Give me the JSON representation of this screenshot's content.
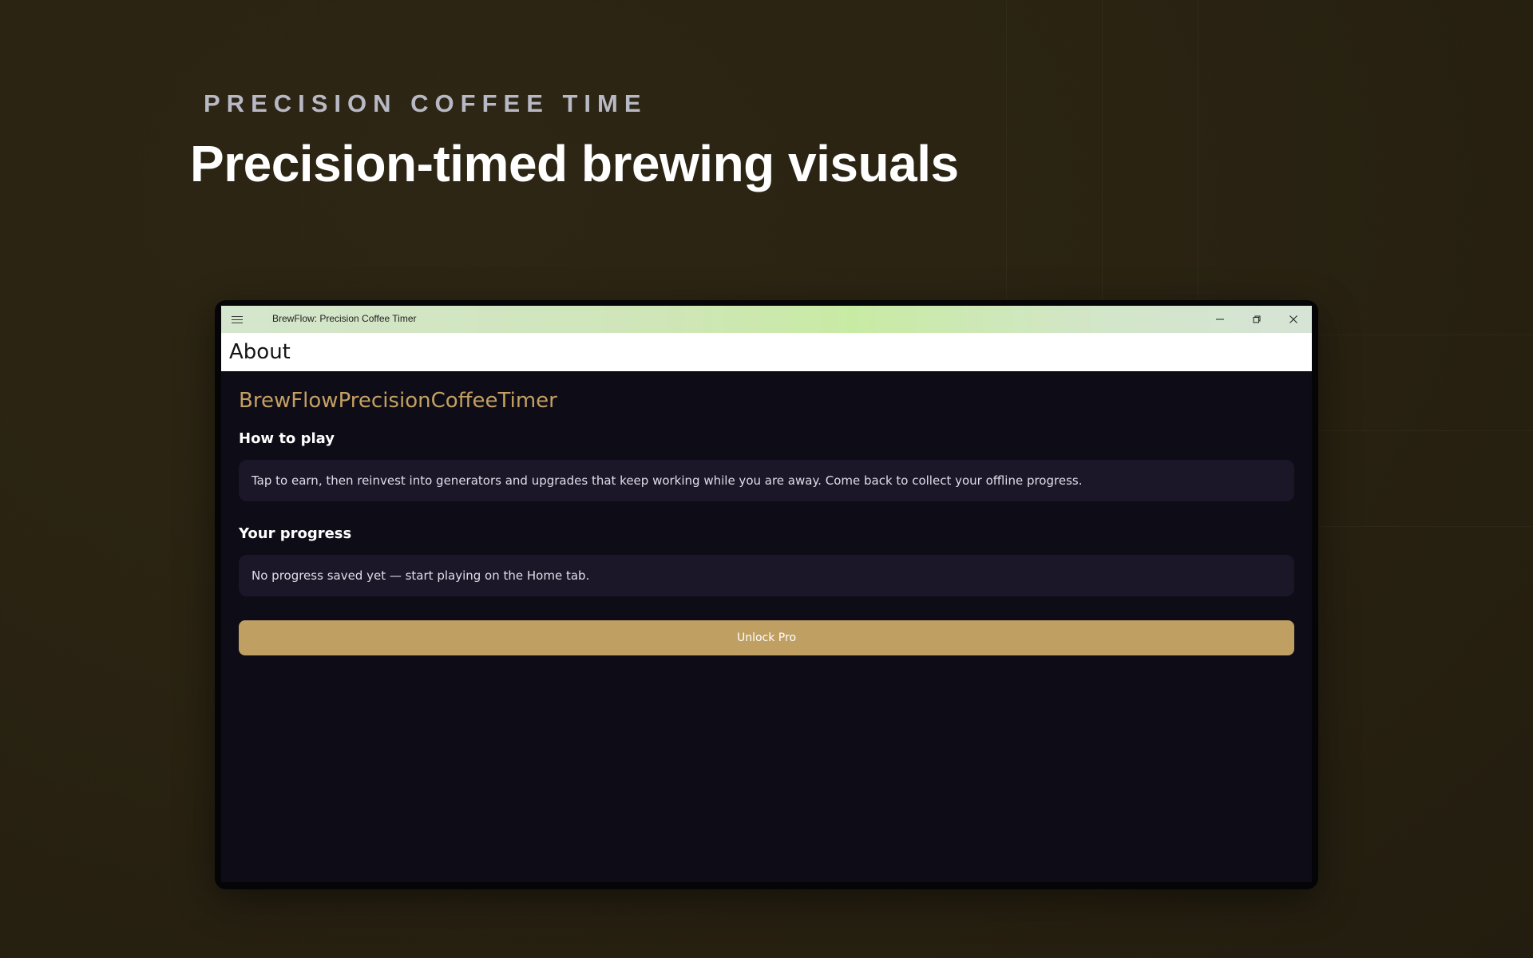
{
  "promo": {
    "eyebrow": "PRECISION COFFEE TIME",
    "headline": "Precision-timed brewing visuals"
  },
  "window": {
    "title": "BrewFlow: Precision Coffee Timer",
    "menu_icon": "hamburger-icon",
    "controls": [
      "minimize-icon",
      "restore-icon",
      "close-icon"
    ]
  },
  "page": {
    "title": "About"
  },
  "about": {
    "app_name": "BrewFlowPrecisionCoffeeTimer",
    "how_to_play_title": "How to play",
    "how_to_play_text": "Tap to earn, then reinvest into generators and upgrades that keep working while you are away. Come back to collect your offline progress.",
    "progress_title": "Your progress",
    "progress_text": "No progress saved yet — start playing on the Home tab.",
    "unlock_label": "Unlock Pro"
  },
  "colors": {
    "accent": "#bf9f62",
    "app_name": "#c4a063",
    "background": "#0e0c16",
    "card": "#1b1628"
  }
}
